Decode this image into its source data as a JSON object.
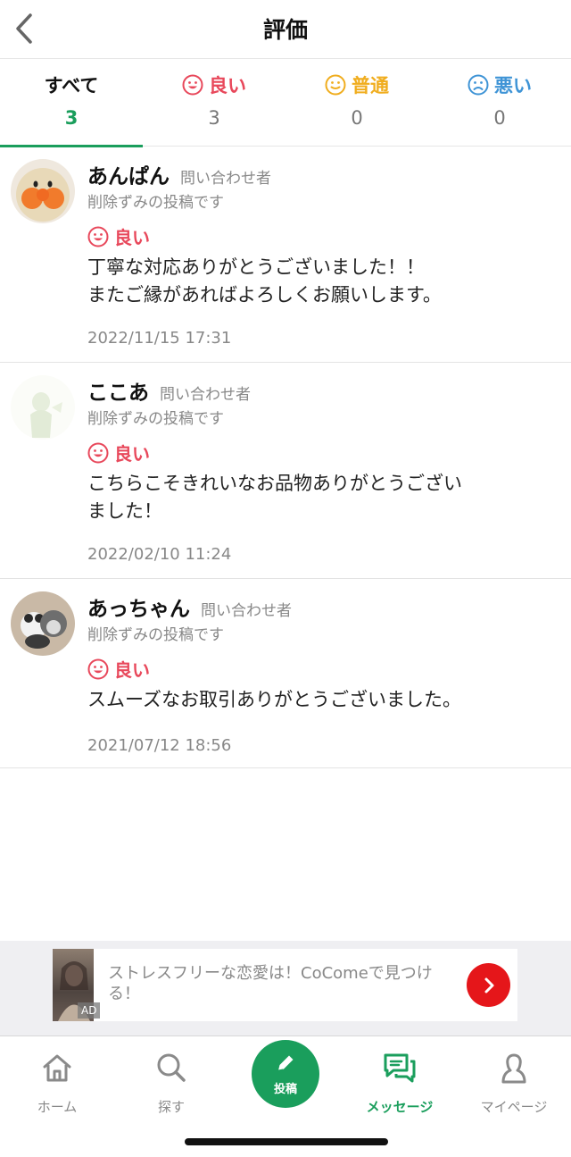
{
  "header": {
    "title": "評価",
    "back_icon": "chevron-left-icon"
  },
  "tabs": [
    {
      "label": "すべて",
      "count": "3",
      "icon": null
    },
    {
      "label": "良い",
      "count": "3",
      "icon": "smile-icon"
    },
    {
      "label": "普通",
      "count": "0",
      "icon": "neutral-face-icon"
    },
    {
      "label": "悪い",
      "count": "0",
      "icon": "sad-face-icon"
    }
  ],
  "colors": {
    "accent": "#1a9e5c",
    "good": "#e8485b",
    "normal": "#f0ad1e",
    "bad": "#3f94d6",
    "ad_button": "#e5161a"
  },
  "reviews": [
    {
      "name": "あんぱん",
      "role": "問い合わせ者",
      "note": "削除ずみの投稿です",
      "rating": "良い",
      "comment": "丁寧な対応ありがとうございました！！\nまたご縁があればよろしくお願いします。",
      "date": "2022/11/15 17:31"
    },
    {
      "name": "ここあ",
      "role": "問い合わせ者",
      "note": "削除ずみの投稿です",
      "rating": "良い",
      "comment": "こちらこそきれいなお品物ありがとうござい\nました！",
      "date": "2022/02/10 11:24"
    },
    {
      "name": "あっちゃん",
      "role": "問い合わせ者",
      "note": "削除ずみの投稿です",
      "rating": "良い",
      "comment": "スムーズなお取引ありがとうございました。",
      "date": "2021/07/12 18:56"
    }
  ],
  "ad": {
    "text": "ストレスフリーな恋愛は！CoComeで見つける！",
    "badge": "AD"
  },
  "nav": {
    "home": "ホーム",
    "search": "探す",
    "post": "投稿",
    "messages": "メッセージ",
    "mypage": "マイページ",
    "active": "messages"
  }
}
